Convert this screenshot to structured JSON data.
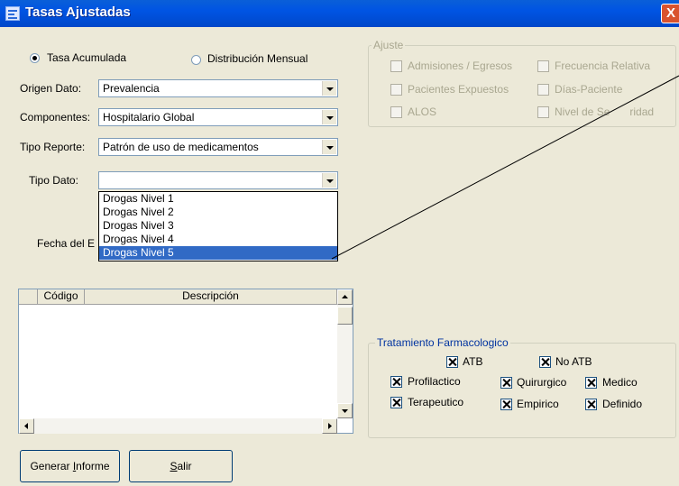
{
  "window": {
    "title": "Tasas Ajustadas",
    "close_label": "X"
  },
  "mode": {
    "option1": "Tasa Acumulada",
    "option2": "Distribución Mensual",
    "selected": "Tasa Acumulada"
  },
  "form": {
    "origen_label": "Origen Dato:",
    "origen_value": "Prevalencia",
    "componentes_label": "Componentes:",
    "componentes_value": "Hospitalario Global",
    "tipo_reporte_label": "Tipo Reporte:",
    "tipo_reporte_value": "Patrón de uso de medicamentos",
    "tipo_dato_label": "Tipo Dato:",
    "tipo_dato_value": "",
    "fecha_label": "Fecha del E"
  },
  "dropdown": {
    "items": [
      "Drogas Nivel 1",
      "Drogas Nivel 2",
      "Drogas Nivel 3",
      "Drogas Nivel 4",
      "Drogas Nivel 5"
    ],
    "selected": "Drogas Nivel 5"
  },
  "ajuste": {
    "title": "Ajuste",
    "admisiones": "Admisiones / Egresos",
    "frecuencia": "Frecuencia Relativa",
    "pacientes": "Pacientes Expuestos",
    "dias": "Días-Paciente",
    "alos": "ALOS",
    "nivel_pre": "Nivel de Se",
    "nivel_post": "ridad"
  },
  "grid": {
    "col_codigo": "Código",
    "col_descripcion": "Descripción"
  },
  "tratamiento": {
    "title": "Tratamiento Farmacologico",
    "atb": "ATB",
    "no_atb": "No ATB",
    "profilactico": "Profilactico",
    "quirurgico": "Quirurgico",
    "medico": "Medico",
    "terapeutico": "Terapeutico",
    "empirico": "Empirico",
    "definido": "Definido"
  },
  "buttons": {
    "generar_pre": "Generar ",
    "generar_u": "I",
    "generar_post": "nforme",
    "salir_u": "S",
    "salir_post": "alir"
  },
  "colors": {
    "titlebar": "#0054e3",
    "selection": "#316ac5",
    "window": "#ece9d8"
  }
}
